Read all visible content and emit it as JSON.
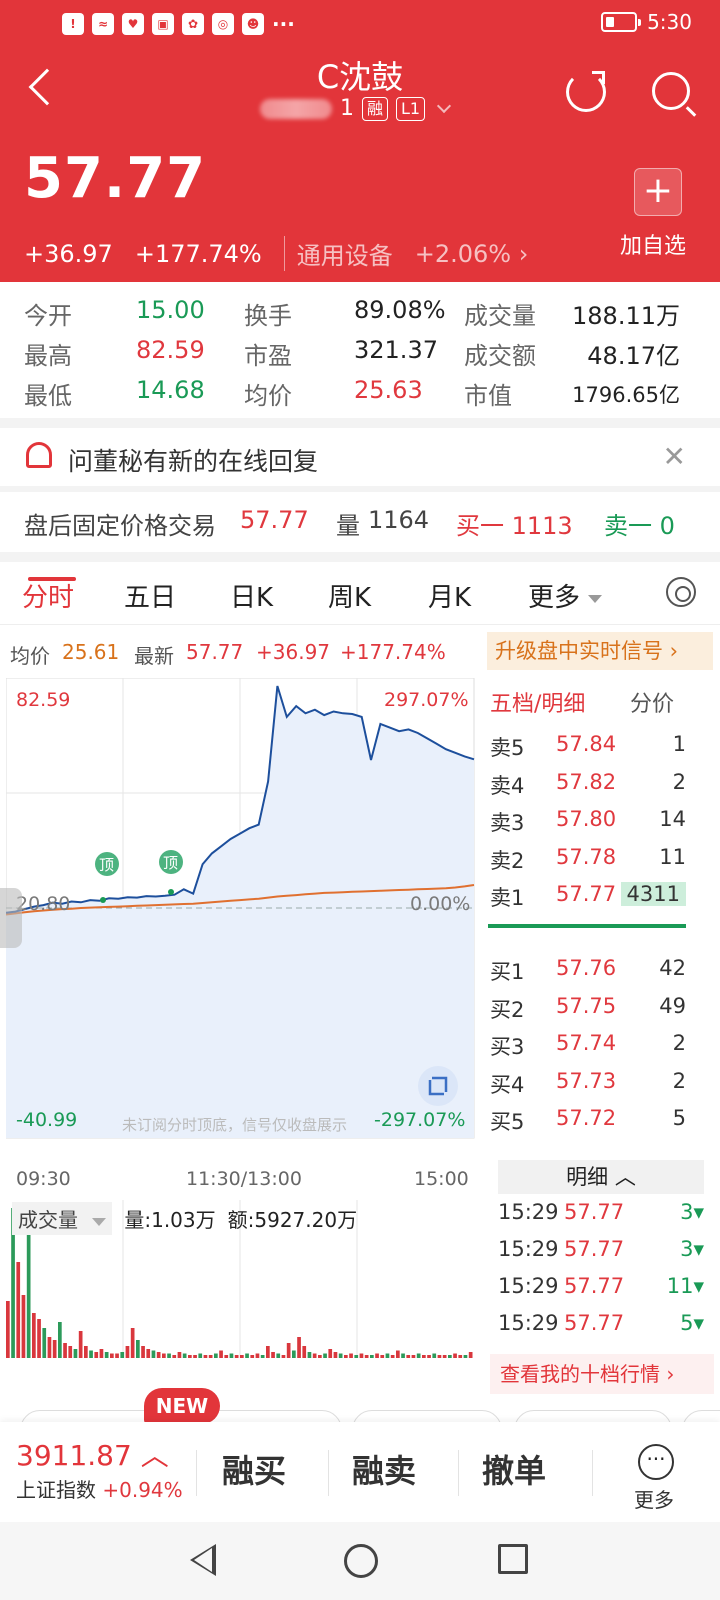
{
  "status_bar": {
    "time": "5:30",
    "dots": "···"
  },
  "header": {
    "title": "C沈鼓",
    "code_suffix": "1",
    "tag_rong": "融",
    "tag_level": "L1",
    "price": "57.77",
    "change": "+36.97",
    "change_pct": "+177.74%",
    "industry": "通用设备",
    "industry_pct": "+2.06%",
    "add_label": "加自选",
    "add_icon": "+"
  },
  "stats": {
    "open_label": "今开",
    "open": "15.00",
    "turnover_label": "换手",
    "turnover": "89.08%",
    "volume_label": "成交量",
    "volume": "188.11万",
    "high_label": "最高",
    "high": "82.59",
    "pe_label": "市盈",
    "pe": "321.37",
    "amount_label": "成交额",
    "amount": "48.17亿",
    "low_label": "最低",
    "low": "14.68",
    "avg_label": "均价",
    "avg": "25.63",
    "mcap_label": "市值",
    "mcap": "1796.65亿"
  },
  "notice": {
    "text": "问董秘有新的在线回复",
    "close": "✕"
  },
  "after_hours": {
    "label": "盘后固定价格交易",
    "price": "57.77",
    "vol_label": "量",
    "vol": "1164",
    "buy1": "买一 1113",
    "sell1": "卖一 0"
  },
  "tabs": [
    "分时",
    "五日",
    "日K",
    "周K",
    "月K",
    "更多"
  ],
  "chart_info": {
    "avg_label": "均价",
    "avg": "25.61",
    "latest_label": "最新",
    "latest": "57.77",
    "change": "+36.97",
    "change_pct": "+177.74%",
    "upgrade": "升级盘中实时信号 ›"
  },
  "chart_data": {
    "type": "line",
    "y_top_label": "82.59",
    "y_mid_label": "20.80",
    "y_bottom_label": "-40.99",
    "pct_top_label": "297.07%",
    "pct_mid_label": "0.00%",
    "pct_bottom_label": "-297.07%",
    "ylim": [
      -40.99,
      82.59
    ],
    "x_labels": [
      "09:30",
      "11:30/13:00",
      "15:00"
    ],
    "marker_label": "顶",
    "watermark": "未订阅分时顶底，信号仅收盘展示",
    "series": [
      {
        "values": [
          19.5,
          19.8,
          20.5,
          21.2,
          21.6,
          22.3,
          22.0,
          22.6,
          22.4,
          23.0,
          22.8,
          23.5,
          23.4,
          23.8,
          23.7,
          24.1,
          24.0,
          24.2,
          24.5,
          26.0,
          24.8,
          33.0,
          36.0,
          38.0,
          40.0,
          41.5,
          43.0,
          44.0,
          56.0,
          82.59,
          74.0,
          77.0,
          75.0,
          76.0,
          74.5,
          75.5,
          75.0,
          74.8,
          74.0,
          62.0,
          72.0,
          71.0,
          70.0,
          70.5,
          69.5,
          68.0,
          66.5,
          65.0,
          64.0,
          63.0,
          62.2
        ]
      },
      {
        "values": [
          19.0,
          19.3,
          19.6,
          19.9,
          20.1,
          20.3,
          20.5,
          20.6,
          20.8,
          20.9,
          21.0,
          21.1,
          21.2,
          21.3,
          21.4,
          21.5,
          21.6,
          21.7,
          21.8,
          21.9,
          22.0,
          22.2,
          22.4,
          22.6,
          22.8,
          23.0,
          23.2,
          23.4,
          23.7,
          24.0,
          24.2,
          24.4,
          24.6,
          24.8,
          25.0,
          25.1,
          25.2,
          25.3,
          25.4,
          25.5,
          25.6,
          25.7,
          25.8,
          25.9,
          26.0,
          26.1,
          26.2,
          26.3,
          26.5,
          26.8,
          27.2
        ]
      }
    ],
    "volume": {
      "label": "成交量",
      "qty": "量:1.03万",
      "amt": "额:5927.20万",
      "values": [
        38,
        100,
        64,
        42,
        88,
        30,
        26,
        20,
        14,
        12,
        24,
        10,
        8,
        6,
        18,
        8,
        5,
        4,
        6,
        4,
        3,
        3,
        4,
        8,
        20,
        12,
        8,
        6,
        5,
        4,
        3,
        3,
        2,
        4,
        3,
        2,
        2,
        3,
        2,
        2,
        3,
        5,
        2,
        3,
        2,
        2,
        3,
        2,
        3,
        2,
        8,
        4,
        3,
        2,
        10,
        5,
        14,
        8,
        4,
        3,
        2,
        3,
        6,
        4,
        3,
        2,
        3,
        2,
        3,
        2,
        2,
        3,
        2,
        3,
        2,
        5,
        3,
        2,
        2,
        3,
        2,
        2,
        3,
        2,
        2,
        2,
        3,
        2,
        2,
        4
      ]
    }
  },
  "orderbook": {
    "tab1": "五档/明细",
    "tab2": "分价",
    "asks": [
      {
        "label": "卖5",
        "price": "57.84",
        "vol": "1"
      },
      {
        "label": "卖4",
        "price": "57.82",
        "vol": "2"
      },
      {
        "label": "卖3",
        "price": "57.80",
        "vol": "14"
      },
      {
        "label": "卖2",
        "price": "57.78",
        "vol": "11"
      },
      {
        "label": "卖1",
        "price": "57.77",
        "vol": "4311"
      }
    ],
    "bids": [
      {
        "label": "买1",
        "price": "57.76",
        "vol": "42"
      },
      {
        "label": "买2",
        "price": "57.75",
        "vol": "49"
      },
      {
        "label": "买3",
        "price": "57.74",
        "vol": "2"
      },
      {
        "label": "买4",
        "price": "57.73",
        "vol": "2"
      },
      {
        "label": "买5",
        "price": "57.72",
        "vol": "5"
      }
    ],
    "detail_header": "明细 ︿",
    "trades": [
      {
        "time": "15:29",
        "price": "57.77",
        "vol": "3▾"
      },
      {
        "time": "15:29",
        "price": "57.77",
        "vol": "3▾"
      },
      {
        "time": "15:29",
        "price": "57.77",
        "vol": "11▾"
      },
      {
        "time": "15:29",
        "price": "57.77",
        "vol": "5▾"
      }
    ],
    "view_ten": "查看我的十档行情  ›"
  },
  "new_badge": "NEW",
  "bottom": {
    "index_value": "3911.87 ︿",
    "index_name": "上证指数",
    "index_pct": "+0.94%",
    "buy": "融买",
    "sell": "融卖",
    "cancel": "撤单",
    "more": "更多",
    "more_icon": "···"
  }
}
